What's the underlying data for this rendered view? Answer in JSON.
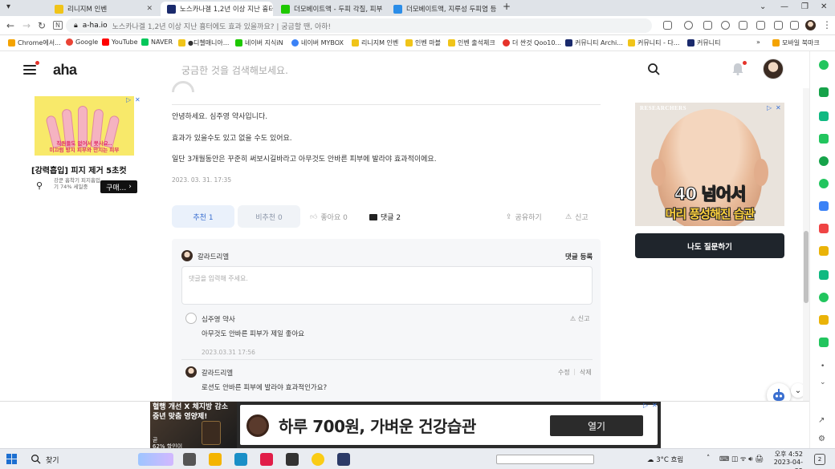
{
  "browser": {
    "tabs": [
      {
        "label": "리니지M 인벤",
        "color": "#f0c419"
      },
      {
        "label": "노스카나겔 1,2년 이상 지난 흉터",
        "color": "#1a2a6c"
      },
      {
        "label": "더모베이트액 - 두피 각질, 피부",
        "color": "#1ec800"
      },
      {
        "label": "더모베이트액, 지루성 두피염 등",
        "color": "#2b8de8"
      }
    ],
    "url": "a-ha.io",
    "page_title": "노스카나겔 1,2년 이상 지난 흉터에도 효과 있을까요? | 궁금할 땐, 아하!",
    "bookmarks": [
      {
        "label": "Chrome에서...",
        "color": "#f4a300"
      },
      {
        "label": "Google",
        "color": "#ea4335"
      },
      {
        "label": "YouTube",
        "color": "#ff0000"
      },
      {
        "label": "NAVER",
        "color": "#03c75a"
      },
      {
        "label": "●디첼매니아...",
        "color": "#f0c419"
      },
      {
        "label": "네이버 지식iN",
        "color": "#1ec800"
      },
      {
        "label": "네이버 MYBOX",
        "color": "#3b82f6"
      },
      {
        "label": "리니지M 인벤",
        "color": "#f0c419"
      },
      {
        "label": "인벤 마블",
        "color": "#f0c419"
      },
      {
        "label": "인벤 출석체크",
        "color": "#f0c419"
      },
      {
        "label": "더 싼것 Qoo10...",
        "color": "#e5332a"
      },
      {
        "label": "커뮤니티 Archi...",
        "color": "#1a2a6c"
      },
      {
        "label": "커뮤니티 - 다...",
        "color": "#f0c419"
      },
      {
        "label": "커뮤니티",
        "color": "#1a2a6c"
      }
    ],
    "bookmarks_more": "»",
    "mobile_bookmarks": "모바일 북마크"
  },
  "header": {
    "logo": "aha",
    "search_placeholder": "궁금한 것을 검색해보세요."
  },
  "left_ad": {
    "image_caption": "직원들도 없어서 못사요..\n미끄럼 방지 피부와 만지는 피부",
    "title": "[강력흡입] 피지 제거 5초컷",
    "meta": "강쿤 흡착기 피지흡입기 74% 세일중",
    "button": "구매..."
  },
  "answer": {
    "paragraphs": [
      "안녕하세요. 심주영 약사입니다.",
      "효과가 있을수도 있고 없을 수도 있어요.",
      "일단 3개월동안은 꾸준히 써보시길바라고 아무것도 안바른 피부에 발라야 효과적이에요."
    ],
    "timestamp": "2023. 03. 31. 17:35"
  },
  "actions": {
    "recommend": "추천 1",
    "not_recommend": "비추천 0",
    "like": "좋아요 0",
    "comments": "댓글 2",
    "share": "공유하기",
    "report": "신고"
  },
  "comments": {
    "current_user": "갈라드리엘",
    "register": "댓글 등록",
    "input_placeholder": "댓글을 입력해 주세요.",
    "items": [
      {
        "author": "심주영 약사",
        "text": "아무것도 안바른 피부가 제일 좋아요",
        "time": "2023.03.31 17:56",
        "action": "신고"
      },
      {
        "author": "갈라드리엘",
        "text": "로션도 안바른 피부에 발라야 효과적인가요?",
        "edit": "수정",
        "sep": "|",
        "delete": "삭제"
      }
    ]
  },
  "right_ad": {
    "brand": "RESEARCHERS",
    "headline": "40 넘어서",
    "subline": "머리 풍성해진 습관"
  },
  "ask_button": "나도 질문하기",
  "bottom_ad": {
    "left_text": "혈행 개선 X 체지방 감소\n중년 맞춤 영양제!",
    "left_small": "곧\n62% 할인이",
    "title": "하루 700원, 가벼운 건강습관",
    "open_button": "열기"
  },
  "taskbar": {
    "search_label": "찾기",
    "weather": "3°C 흐림",
    "time": "오후 4:52",
    "date": "2023-04-25",
    "notif_count": "2"
  }
}
